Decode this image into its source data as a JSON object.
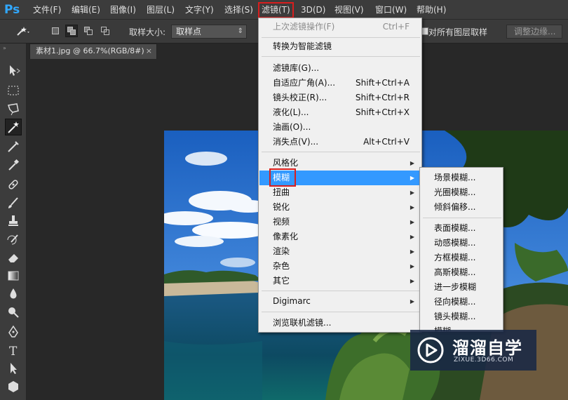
{
  "app": {
    "logo": "Ps"
  },
  "menubar": {
    "items": [
      "文件(F)",
      "编辑(E)",
      "图像(I)",
      "图层(L)",
      "文字(Y)",
      "选择(S)",
      "滤镜(T)",
      "3D(D)",
      "视图(V)",
      "窗口(W)",
      "帮助(H)"
    ],
    "active": "滤镜(T)"
  },
  "options_bar": {
    "sample_size_label": "取样大小:",
    "sample_size_value": "取样点",
    "sample_all_layers_label": "对所有图层取样",
    "refine_edge_label": "调整边缘..."
  },
  "document": {
    "tab_title": "素材1.jpg @ 66.7%(RGB/8#)",
    "close_glyph": "×"
  },
  "filter_menu": {
    "items": [
      {
        "label": "上次滤镜操作(F)",
        "shortcut": "Ctrl+F",
        "disabled": true
      },
      {
        "label": "转换为智能滤镜"
      },
      {
        "label": "滤镜库(G)..."
      },
      {
        "label": "自适应广角(A)...",
        "shortcut": "Shift+Ctrl+A"
      },
      {
        "label": "镜头校正(R)...",
        "shortcut": "Shift+Ctrl+R"
      },
      {
        "label": "液化(L)...",
        "shortcut": "Shift+Ctrl+X"
      },
      {
        "label": "油画(O)..."
      },
      {
        "label": "消失点(V)...",
        "shortcut": "Alt+Ctrl+V"
      },
      {
        "label": "风格化",
        "submenu": true
      },
      {
        "label": "模糊",
        "submenu": true,
        "highlighted": true
      },
      {
        "label": "扭曲",
        "submenu": true
      },
      {
        "label": "锐化",
        "submenu": true
      },
      {
        "label": "视频",
        "submenu": true
      },
      {
        "label": "像素化",
        "submenu": true
      },
      {
        "label": "渲染",
        "submenu": true
      },
      {
        "label": "杂色",
        "submenu": true
      },
      {
        "label": "其它",
        "submenu": true
      },
      {
        "label": "Digimarc",
        "submenu": true
      },
      {
        "label": "浏览联机滤镜..."
      }
    ],
    "submenu_arrow": "▶"
  },
  "blur_submenu": {
    "items": [
      "场景模糊...",
      "光圈模糊...",
      "倾斜偏移...",
      "表面模糊...",
      "动感模糊...",
      "方框模糊...",
      "高斯模糊...",
      "进一步模糊",
      "径向模糊...",
      "镜头模糊...",
      "模糊"
    ]
  },
  "watermark": {
    "title": "溜溜自学",
    "url": "ZIXUE.3D66.COM"
  },
  "colors": {
    "highlight": "#3399ff",
    "annotation_red": "#d81e1e",
    "menu_bg": "#f0f0f0",
    "ui_dark": "#3c3c3c"
  }
}
